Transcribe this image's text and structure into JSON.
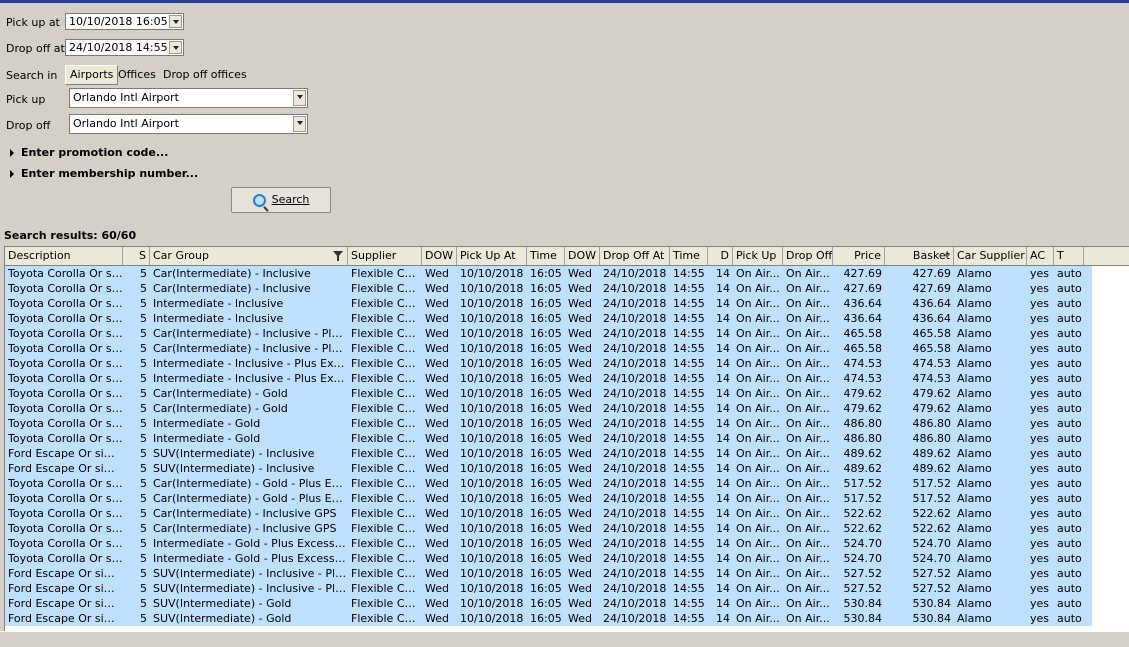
{
  "form": {
    "pickup_at_label": "Pick up at",
    "pickup_at_value": "10/10/2018 16:05",
    "dropoff_at_label": "Drop off at",
    "dropoff_at_value": "24/10/2018 14:55",
    "search_in_label": "Search in",
    "tabs": [
      "Airports",
      "Offices",
      "Drop off offices"
    ],
    "pickup_label": "Pick up",
    "pickup_value": "Orlando Intl Airport",
    "dropoff_label": "Drop off",
    "dropoff_value": "Orlando Intl Airport",
    "promotion_label": "Enter promotion code...",
    "membership_label": "Enter membership number...",
    "search_button": "Search"
  },
  "results": {
    "label": "Search results: 60/60",
    "columns": [
      "Description",
      "S",
      "Car Group",
      "Supplier",
      "DOW",
      "Pick Up At",
      "Time",
      "DOW",
      "Drop Off At",
      "Time",
      "D",
      "Pick Up",
      "Drop Off",
      "Price",
      "Basket",
      "Car Supplier",
      "AC",
      "T"
    ],
    "rows": [
      [
        "Toyota Corolla Or si...",
        "5",
        "Car(Intermediate) - Inclusive",
        "Flexible Car...",
        "Wed",
        "10/10/2018",
        "16:05",
        "Wed",
        "24/10/2018",
        "14:55",
        "14",
        "On Air...",
        "On Air...",
        "427.69",
        "427.69",
        "Alamo",
        "yes",
        "auto"
      ],
      [
        "Toyota Corolla Or si...",
        "5",
        "Car(Intermediate) - Inclusive",
        "Flexible Car...",
        "Wed",
        "10/10/2018",
        "16:05",
        "Wed",
        "24/10/2018",
        "14:55",
        "14",
        "On Air...",
        "On Air...",
        "427.69",
        "427.69",
        "Alamo",
        "yes",
        "auto"
      ],
      [
        "Toyota Corolla Or si...",
        "5",
        "Intermediate - Inclusive",
        "Flexible Car...",
        "Wed",
        "10/10/2018",
        "16:05",
        "Wed",
        "24/10/2018",
        "14:55",
        "14",
        "On Air...",
        "On Air...",
        "436.64",
        "436.64",
        "Alamo",
        "yes",
        "auto"
      ],
      [
        "Toyota Corolla Or si...",
        "5",
        "Intermediate - Inclusive",
        "Flexible Car...",
        "Wed",
        "10/10/2018",
        "16:05",
        "Wed",
        "24/10/2018",
        "14:55",
        "14",
        "On Air...",
        "On Air...",
        "436.64",
        "436.64",
        "Alamo",
        "yes",
        "auto"
      ],
      [
        "Toyota Corolla Or si...",
        "5",
        "Car(Intermediate) - Inclusive - Plus E...",
        "Flexible Car...",
        "Wed",
        "10/10/2018",
        "16:05",
        "Wed",
        "24/10/2018",
        "14:55",
        "14",
        "On Air...",
        "On Air...",
        "465.58",
        "465.58",
        "Alamo",
        "yes",
        "auto"
      ],
      [
        "Toyota Corolla Or si...",
        "5",
        "Car(Intermediate) - Inclusive - Plus E...",
        "Flexible Car...",
        "Wed",
        "10/10/2018",
        "16:05",
        "Wed",
        "24/10/2018",
        "14:55",
        "14",
        "On Air...",
        "On Air...",
        "465.58",
        "465.58",
        "Alamo",
        "yes",
        "auto"
      ],
      [
        "Toyota Corolla Or si...",
        "5",
        "Intermediate - Inclusive - Plus Excess ...",
        "Flexible Car...",
        "Wed",
        "10/10/2018",
        "16:05",
        "Wed",
        "24/10/2018",
        "14:55",
        "14",
        "On Air...",
        "On Air...",
        "474.53",
        "474.53",
        "Alamo",
        "yes",
        "auto"
      ],
      [
        "Toyota Corolla Or si...",
        "5",
        "Intermediate - Inclusive - Plus Excess ...",
        "Flexible Car...",
        "Wed",
        "10/10/2018",
        "16:05",
        "Wed",
        "24/10/2018",
        "14:55",
        "14",
        "On Air...",
        "On Air...",
        "474.53",
        "474.53",
        "Alamo",
        "yes",
        "auto"
      ],
      [
        "Toyota Corolla Or si...",
        "5",
        "Car(Intermediate) - Gold",
        "Flexible Car...",
        "Wed",
        "10/10/2018",
        "16:05",
        "Wed",
        "24/10/2018",
        "14:55",
        "14",
        "On Air...",
        "On Air...",
        "479.62",
        "479.62",
        "Alamo",
        "yes",
        "auto"
      ],
      [
        "Toyota Corolla Or si...",
        "5",
        "Car(Intermediate) - Gold",
        "Flexible Car...",
        "Wed",
        "10/10/2018",
        "16:05",
        "Wed",
        "24/10/2018",
        "14:55",
        "14",
        "On Air...",
        "On Air...",
        "479.62",
        "479.62",
        "Alamo",
        "yes",
        "auto"
      ],
      [
        "Toyota Corolla Or si...",
        "5",
        "Intermediate - Gold",
        "Flexible Car...",
        "Wed",
        "10/10/2018",
        "16:05",
        "Wed",
        "24/10/2018",
        "14:55",
        "14",
        "On Air...",
        "On Air...",
        "486.80",
        "486.80",
        "Alamo",
        "yes",
        "auto"
      ],
      [
        "Toyota Corolla Or si...",
        "5",
        "Intermediate - Gold",
        "Flexible Car...",
        "Wed",
        "10/10/2018",
        "16:05",
        "Wed",
        "24/10/2018",
        "14:55",
        "14",
        "On Air...",
        "On Air...",
        "486.80",
        "486.80",
        "Alamo",
        "yes",
        "auto"
      ],
      [
        "Ford Escape Or simila...",
        "5",
        "SUV(Intermediate) - Inclusive",
        "Flexible Car...",
        "Wed",
        "10/10/2018",
        "16:05",
        "Wed",
        "24/10/2018",
        "14:55",
        "14",
        "On Air...",
        "On Air...",
        "489.62",
        "489.62",
        "Alamo",
        "yes",
        "auto"
      ],
      [
        "Ford Escape Or simila...",
        "5",
        "SUV(Intermediate) - Inclusive",
        "Flexible Car...",
        "Wed",
        "10/10/2018",
        "16:05",
        "Wed",
        "24/10/2018",
        "14:55",
        "14",
        "On Air...",
        "On Air...",
        "489.62",
        "489.62",
        "Alamo",
        "yes",
        "auto"
      ],
      [
        "Toyota Corolla Or si...",
        "5",
        "Car(Intermediate) - Gold - Plus Exces...",
        "Flexible Car...",
        "Wed",
        "10/10/2018",
        "16:05",
        "Wed",
        "24/10/2018",
        "14:55",
        "14",
        "On Air...",
        "On Air...",
        "517.52",
        "517.52",
        "Alamo",
        "yes",
        "auto"
      ],
      [
        "Toyota Corolla Or si...",
        "5",
        "Car(Intermediate) - Gold - Plus Exces...",
        "Flexible Car...",
        "Wed",
        "10/10/2018",
        "16:05",
        "Wed",
        "24/10/2018",
        "14:55",
        "14",
        "On Air...",
        "On Air...",
        "517.52",
        "517.52",
        "Alamo",
        "yes",
        "auto"
      ],
      [
        "Toyota Corolla Or si...",
        "5",
        "Car(Intermediate) - Inclusive GPS",
        "Flexible Car...",
        "Wed",
        "10/10/2018",
        "16:05",
        "Wed",
        "24/10/2018",
        "14:55",
        "14",
        "On Air...",
        "On Air...",
        "522.62",
        "522.62",
        "Alamo",
        "yes",
        "auto"
      ],
      [
        "Toyota Corolla Or si...",
        "5",
        "Car(Intermediate) - Inclusive GPS",
        "Flexible Car...",
        "Wed",
        "10/10/2018",
        "16:05",
        "Wed",
        "24/10/2018",
        "14:55",
        "14",
        "On Air...",
        "On Air...",
        "522.62",
        "522.62",
        "Alamo",
        "yes",
        "auto"
      ],
      [
        "Toyota Corolla Or si...",
        "5",
        "Intermediate - Gold - Plus Excess Ref...",
        "Flexible Car...",
        "Wed",
        "10/10/2018",
        "16:05",
        "Wed",
        "24/10/2018",
        "14:55",
        "14",
        "On Air...",
        "On Air...",
        "524.70",
        "524.70",
        "Alamo",
        "yes",
        "auto"
      ],
      [
        "Toyota Corolla Or si...",
        "5",
        "Intermediate - Gold - Plus Excess Ref...",
        "Flexible Car...",
        "Wed",
        "10/10/2018",
        "16:05",
        "Wed",
        "24/10/2018",
        "14:55",
        "14",
        "On Air...",
        "On Air...",
        "524.70",
        "524.70",
        "Alamo",
        "yes",
        "auto"
      ],
      [
        "Ford Escape Or simila...",
        "5",
        "SUV(Intermediate) - Inclusive - Plus E...",
        "Flexible Car...",
        "Wed",
        "10/10/2018",
        "16:05",
        "Wed",
        "24/10/2018",
        "14:55",
        "14",
        "On Air...",
        "On Air...",
        "527.52",
        "527.52",
        "Alamo",
        "yes",
        "auto"
      ],
      [
        "Ford Escape Or simila...",
        "5",
        "SUV(Intermediate) - Inclusive - Plus E...",
        "Flexible Car...",
        "Wed",
        "10/10/2018",
        "16:05",
        "Wed",
        "24/10/2018",
        "14:55",
        "14",
        "On Air...",
        "On Air...",
        "527.52",
        "527.52",
        "Alamo",
        "yes",
        "auto"
      ],
      [
        "Ford Escape Or simila...",
        "5",
        "SUV(Intermediate) - Gold",
        "Flexible Car...",
        "Wed",
        "10/10/2018",
        "16:05",
        "Wed",
        "24/10/2018",
        "14:55",
        "14",
        "On Air...",
        "On Air...",
        "530.84",
        "530.84",
        "Alamo",
        "yes",
        "auto"
      ],
      [
        "Ford Escape Or simila...",
        "5",
        "SUV(Intermediate) - Gold",
        "Flexible Car...",
        "Wed",
        "10/10/2018",
        "16:05",
        "Wed",
        "24/10/2018",
        "14:55",
        "14",
        "On Air...",
        "On Air...",
        "530.84",
        "530.84",
        "Alamo",
        "yes",
        "auto"
      ]
    ]
  },
  "colors": {
    "window_bg": "#d4d0c8",
    "row_selected": "#bfe0ff",
    "title_accent": "#2c3e8c"
  }
}
